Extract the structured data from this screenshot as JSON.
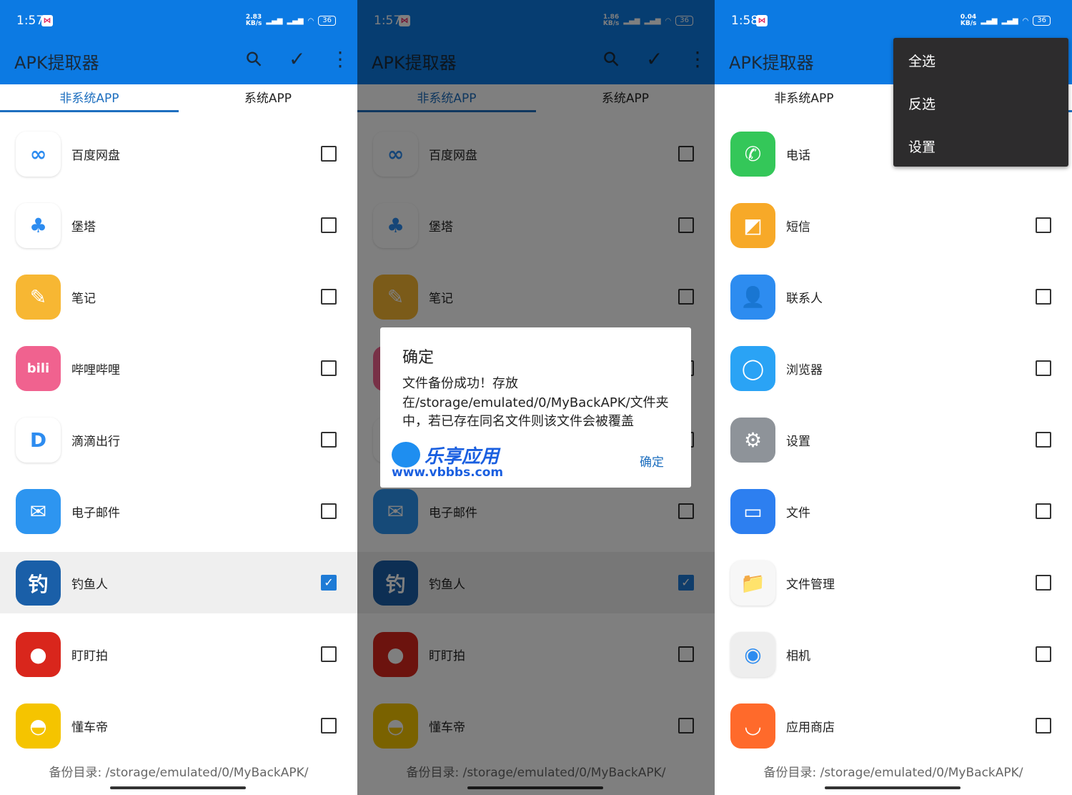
{
  "colors": {
    "primary": "#0c7ae3",
    "accent": "#1e6fbf",
    "menu_bg": "#2d2c2d"
  },
  "app_title": "APK提取器",
  "tabs": [
    "非系统APP",
    "系统APP"
  ],
  "footer": "备份目录: /storage/emulated/0/MyBackAPK/",
  "toolbar_icons": [
    "search-icon",
    "check-icon",
    "more-vert-icon"
  ],
  "panels": [
    {
      "time": "1:57",
      "speed": [
        "2.83",
        "KB/s"
      ],
      "battery": "36",
      "active_tab": 0,
      "apps": [
        {
          "name": "百度网盘",
          "icon": "baidu-netdisk-icon",
          "color": "#ffffff",
          "glyph": "∞",
          "checked": false
        },
        {
          "name": "堡塔",
          "icon": "baota-icon",
          "color": "#ffffff",
          "glyph": "♣",
          "checked": false
        },
        {
          "name": "笔记",
          "icon": "notes-icon",
          "color": "#f7b733",
          "glyph": "✎",
          "checked": false
        },
        {
          "name": "哔哩哔哩",
          "icon": "bilibili-icon",
          "color": "#f0628f",
          "glyph": "bili",
          "checked": false
        },
        {
          "name": "滴滴出行",
          "icon": "didi-icon",
          "color": "#ffffff",
          "glyph": "D",
          "checked": false
        },
        {
          "name": "电子邮件",
          "icon": "email-icon",
          "color": "#2d95f0",
          "glyph": "✉",
          "checked": false
        },
        {
          "name": "钓鱼人",
          "icon": "fishing-icon",
          "color": "#1a5fa8",
          "glyph": "钓",
          "checked": true
        },
        {
          "name": "盯盯拍",
          "icon": "ddpai-icon",
          "color": "#d9261c",
          "glyph": "●",
          "checked": false
        },
        {
          "name": "懂车帝",
          "icon": "dongchedi-icon",
          "color": "#f5c400",
          "glyph": "◓",
          "checked": false
        }
      ]
    },
    {
      "time": "1:57",
      "speed": [
        "1.86",
        "KB/s"
      ],
      "battery": "36",
      "active_tab": 0,
      "dialog": {
        "title": "确定",
        "message": "文件备份成功！存放在/storage/emulated/0/MyBackAPK/文件夹中，若已存在同名文件则该文件会被覆盖",
        "ok": "确定",
        "watermark": [
          "乐享应用",
          "www.vbbbs.com"
        ]
      },
      "apps": [
        {
          "name": "百度网盘",
          "icon": "baidu-netdisk-icon",
          "color": "#ffffff",
          "glyph": "∞",
          "checked": false
        },
        {
          "name": "堡塔",
          "icon": "baota-icon",
          "color": "#ffffff",
          "glyph": "♣",
          "checked": false
        },
        {
          "name": "笔记",
          "icon": "notes-icon",
          "color": "#f7b733",
          "glyph": "✎",
          "checked": false
        },
        {
          "name": "哔哩哔哩",
          "icon": "bilibili-icon",
          "color": "#f0628f",
          "glyph": "bili",
          "checked": false
        },
        {
          "name": "滴滴出行",
          "icon": "didi-icon",
          "color": "#ffffff",
          "glyph": "D",
          "checked": false
        },
        {
          "name": "电子邮件",
          "icon": "email-icon",
          "color": "#2d95f0",
          "glyph": "✉",
          "checked": false
        },
        {
          "name": "钓鱼人",
          "icon": "fishing-icon",
          "color": "#1a5fa8",
          "glyph": "钓",
          "checked": true
        },
        {
          "name": "盯盯拍",
          "icon": "ddpai-icon",
          "color": "#d9261c",
          "glyph": "●",
          "checked": false
        },
        {
          "name": "懂车帝",
          "icon": "dongchedi-icon",
          "color": "#f5c400",
          "glyph": "◓",
          "checked": false
        }
      ]
    },
    {
      "time": "1:58",
      "speed": [
        "0.04",
        "KB/s"
      ],
      "battery": "36",
      "active_tab": 1,
      "menu": [
        "全选",
        "反选",
        "设置"
      ],
      "apps": [
        {
          "name": "电话",
          "icon": "phone-icon",
          "color": "#34c759",
          "glyph": "✆",
          "checked": false
        },
        {
          "name": "短信",
          "icon": "messages-icon",
          "color": "#f7a928",
          "glyph": "◩",
          "checked": false
        },
        {
          "name": "联系人",
          "icon": "contacts-icon",
          "color": "#2d8cf0",
          "glyph": "👤",
          "checked": false
        },
        {
          "name": "浏览器",
          "icon": "browser-icon",
          "color": "#2aa3f5",
          "glyph": "◯",
          "checked": false
        },
        {
          "name": "设置",
          "icon": "settings-icon",
          "color": "#8e9399",
          "glyph": "⚙",
          "checked": false
        },
        {
          "name": "文件",
          "icon": "files-icon",
          "color": "#2d7ff0",
          "glyph": "▭",
          "checked": false
        },
        {
          "name": "文件管理",
          "icon": "file-manager-icon",
          "color": "#f7f7f7",
          "glyph": "📁",
          "checked": false
        },
        {
          "name": "相机",
          "icon": "camera-icon",
          "color": "#eeeeee",
          "glyph": "◉",
          "checked": false
        },
        {
          "name": "应用商店",
          "icon": "app-store-icon",
          "color": "#ff6a2b",
          "glyph": "◡",
          "checked": false
        }
      ]
    }
  ]
}
